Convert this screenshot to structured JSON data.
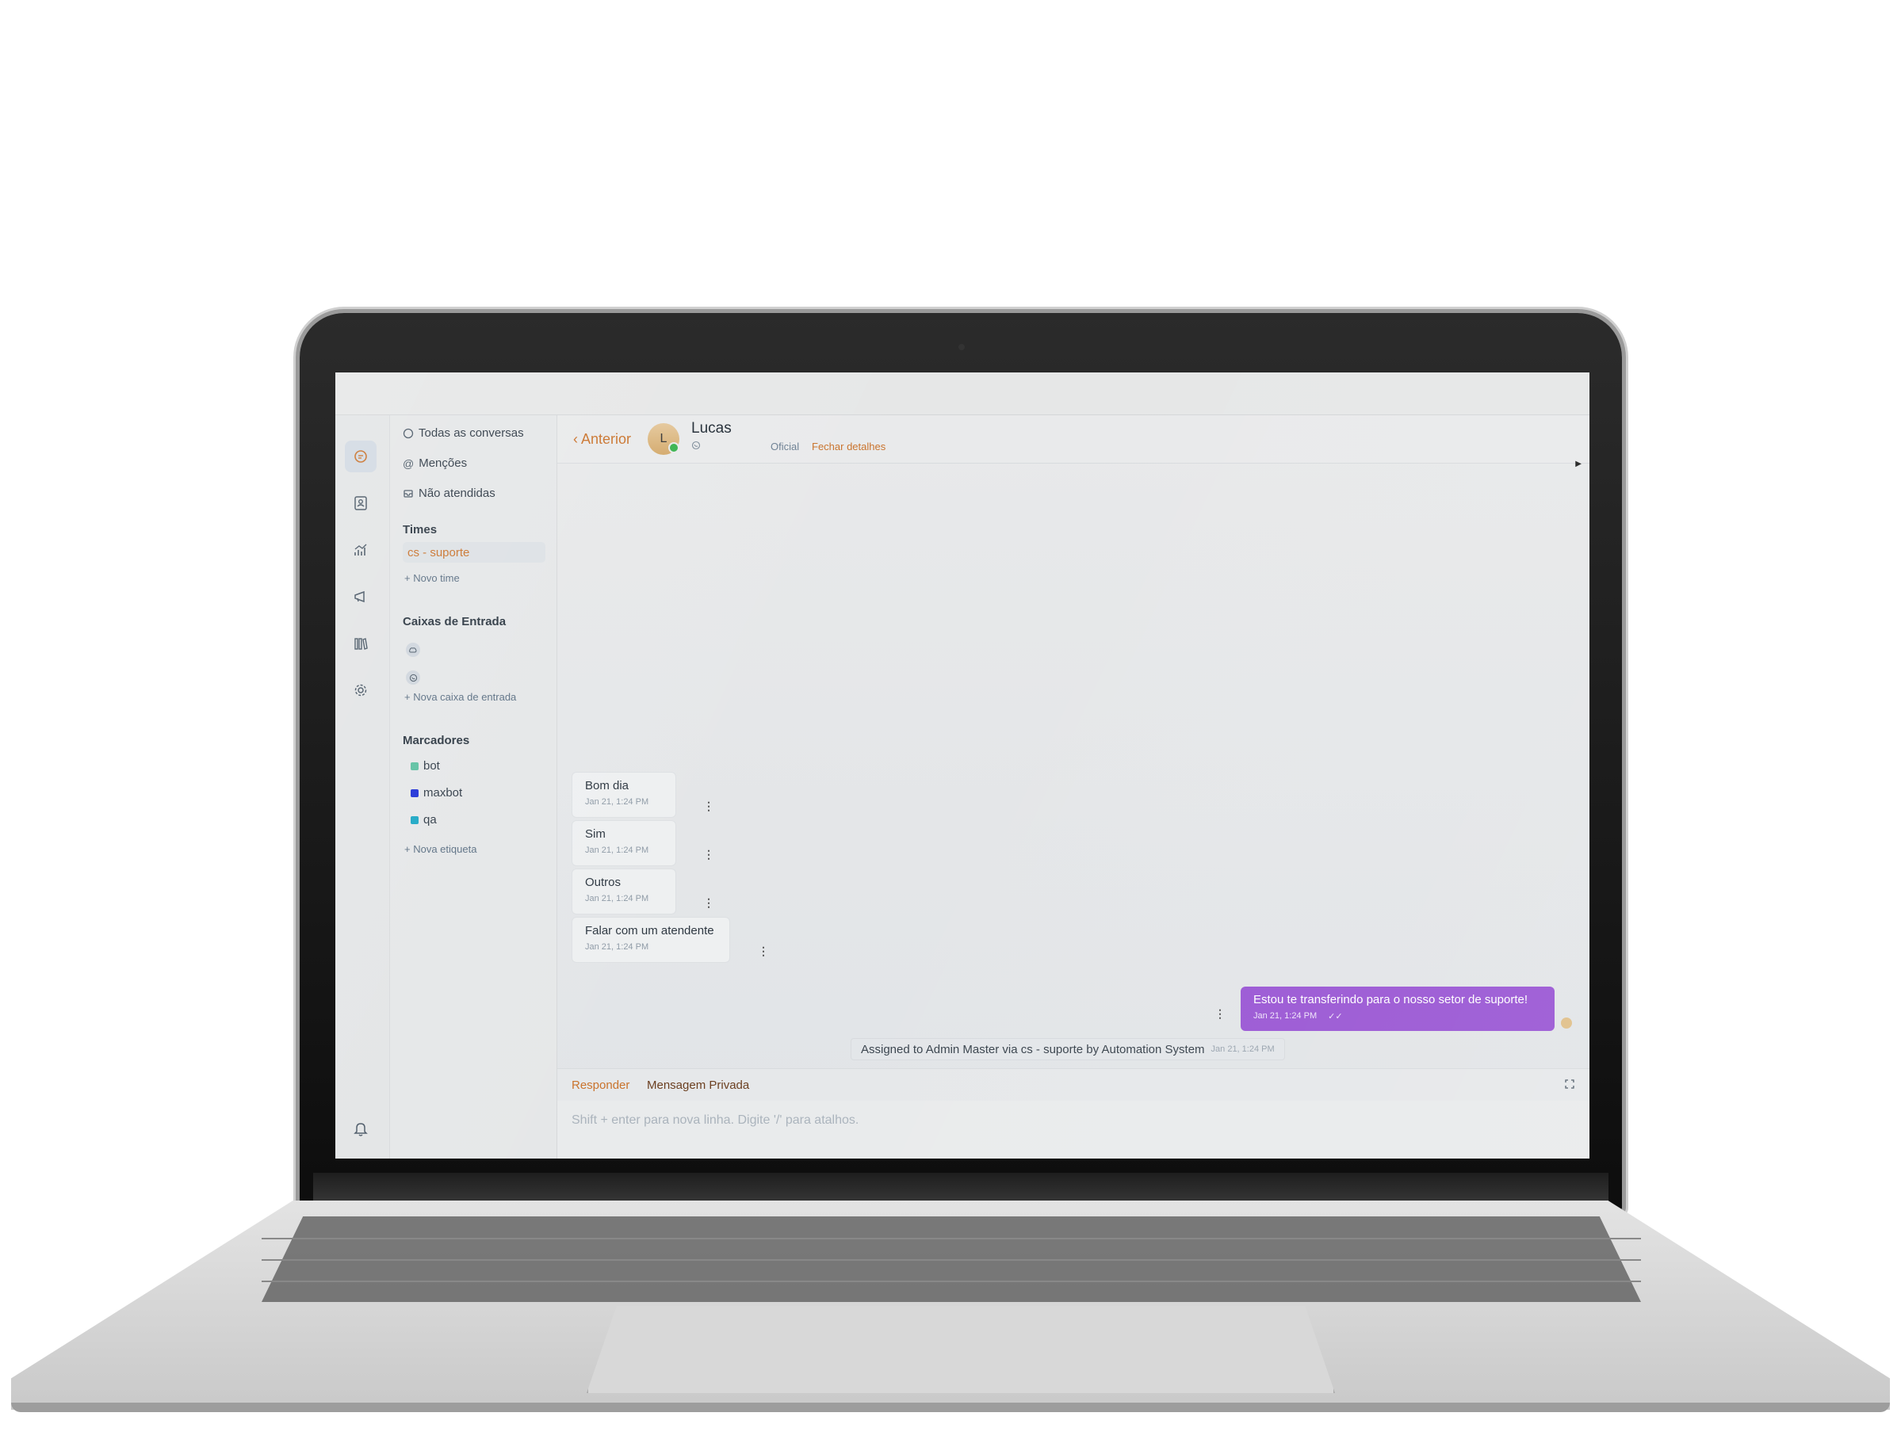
{
  "sidebar": {
    "nav": [
      {
        "label": "Todas as conversas",
        "icon": "chat-icon"
      },
      {
        "label": "Menções",
        "icon": "at-icon"
      },
      {
        "label": "Não atendidas",
        "icon": "inbox-icon"
      }
    ],
    "teams_title": "Times",
    "teams": [
      {
        "label": "cs - suporte"
      }
    ],
    "new_team": "+ Novo time",
    "inboxes_title": "Caixas de Entrada",
    "inboxes": [
      {
        "icon": "cloud-icon"
      },
      {
        "icon": "whatsapp-icon"
      }
    ],
    "new_inbox": "+ Nova caixa de entrada",
    "labels_title": "Marcadores",
    "labels": [
      {
        "label": "bot",
        "color": "#5bbfa0"
      },
      {
        "label": "maxbot",
        "color": "#1d2fd6"
      },
      {
        "label": "qa",
        "color": "#1aa6c4"
      }
    ],
    "new_label": "+ Nova etiqueta"
  },
  "header": {
    "back_label": "Anterior",
    "avatar_initial": "L",
    "contact_name": "Lucas",
    "status": "Oficial",
    "close_details": "Fechar detalhes"
  },
  "messages": {
    "incoming": [
      {
        "text": "Bom dia",
        "time": "Jan 21, 1:24 PM"
      },
      {
        "text": "Sim",
        "time": "Jan 21, 1:24 PM"
      },
      {
        "text": "Outros",
        "time": "Jan 21, 1:24 PM"
      },
      {
        "text": "Falar com um atendente",
        "time": "Jan 21, 1:24 PM"
      }
    ],
    "outgoing": {
      "text": "Estou te transferindo para o nosso setor de suporte!",
      "time": "Jan 21, 1:24 PM"
    },
    "activity": {
      "text": "Assigned to Admin Master via cs - suporte by Automation System",
      "time": "Jan 21, 1:24 PM"
    }
  },
  "reply": {
    "tab_reply": "Responder",
    "tab_private": "Mensagem Privada",
    "placeholder": "Shift + enter para nova linha. Digite '/' para atalhos."
  },
  "colors": {
    "accent": "#c9722b",
    "outgoing_bubble": "#9a57d4"
  }
}
